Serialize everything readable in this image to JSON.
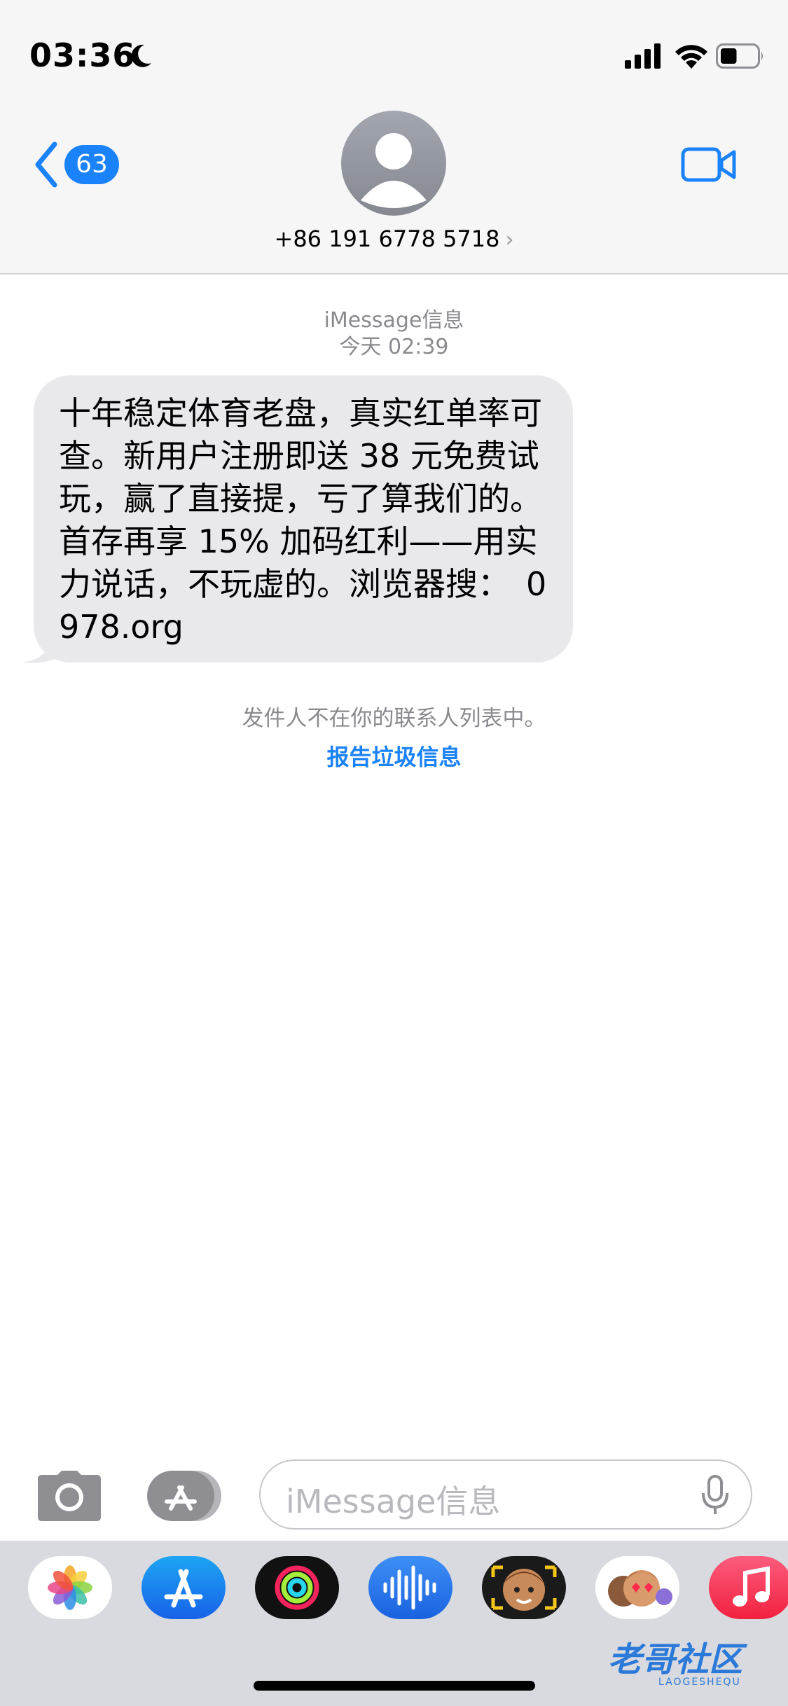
{
  "status_bar": {
    "time": "03:36",
    "focus_icon": "moon-icon",
    "signal_icon": "cellular-signal-icon",
    "wifi_icon": "wifi-icon",
    "battery_icon": "battery-icon",
    "battery_level": 0.45
  },
  "header": {
    "back_icon": "chevron-left-icon",
    "unread_count": "63",
    "avatar_icon": "person-icon",
    "contact": "+86 191 6778 5718",
    "contact_chevron": "›",
    "facetime_icon": "video-camera-icon"
  },
  "conversation": {
    "service": "iMessage信息",
    "timestamp": "今天 02:39",
    "message_text": "十年稳定体育老盘，真实红单率可查。新用户注册即送 38 元免费试玩，赢了直接提，亏了算我们的。首存再享 15% 加码红利——用实力说话，不玩虚的。浏览器搜：　0978.org",
    "notice": "发件人不在你的联系人列表中。",
    "report_link": "报告垃圾信息"
  },
  "input_bar": {
    "camera_icon": "camera-icon",
    "apps_icon": "app-store-icon",
    "placeholder": "iMessage信息",
    "mic_icon": "microphone-icon"
  },
  "app_tray": {
    "apps": [
      "photos-icon",
      "app-store-icon",
      "activity-icon",
      "voice-memo-icon",
      "memoji-icon",
      "memoji-stickers-icon",
      "music-icon"
    ]
  },
  "watermark": {
    "text": "老哥社区",
    "sub": "LAOGESHEQU"
  },
  "colors": {
    "accent": "#1a82fb",
    "bubble": "#e9e9eb",
    "header_bg": "#f6f6f6",
    "tray_bg": "#d8dadf"
  }
}
